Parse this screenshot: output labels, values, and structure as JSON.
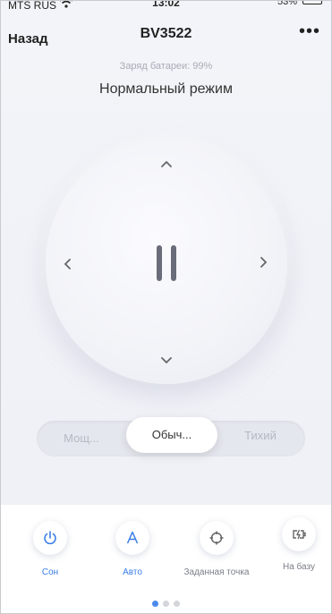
{
  "status_bar": {
    "carrier": "MTS RUS",
    "time": "13:02",
    "battery": "53%"
  },
  "header": {
    "back_label": "Назад",
    "title": "BV3522",
    "more_icon": "ellipsis-icon"
  },
  "battery_text": "Заряд батареи: 99%",
  "mode_text": "Нормальный режим",
  "joystick": {
    "up_icon": "chevron-up-icon",
    "down_icon": "chevron-down-icon",
    "left_icon": "chevron-left-icon",
    "right_icon": "chevron-right-icon",
    "center_icon": "pause-icon"
  },
  "suction": {
    "options": [
      "Мощ...",
      "Обыч...",
      "Тихий"
    ],
    "selected_index": 1
  },
  "actions": [
    {
      "label": "Сон",
      "icon": "power-icon",
      "color": "#3a7de8"
    },
    {
      "label": "Авто",
      "icon": "letter-a-icon",
      "color": "#3a7de8"
    },
    {
      "label": "Заданная точка",
      "icon": "crosshair-icon",
      "color": "#7a7d88"
    },
    {
      "label": "На базу",
      "icon": "charging-battery-icon",
      "color": "#7a7d88"
    }
  ],
  "pager": {
    "count": 3,
    "active_index": 0
  },
  "colors": {
    "accent": "#3a7de8",
    "background": "#f1f2f7"
  }
}
